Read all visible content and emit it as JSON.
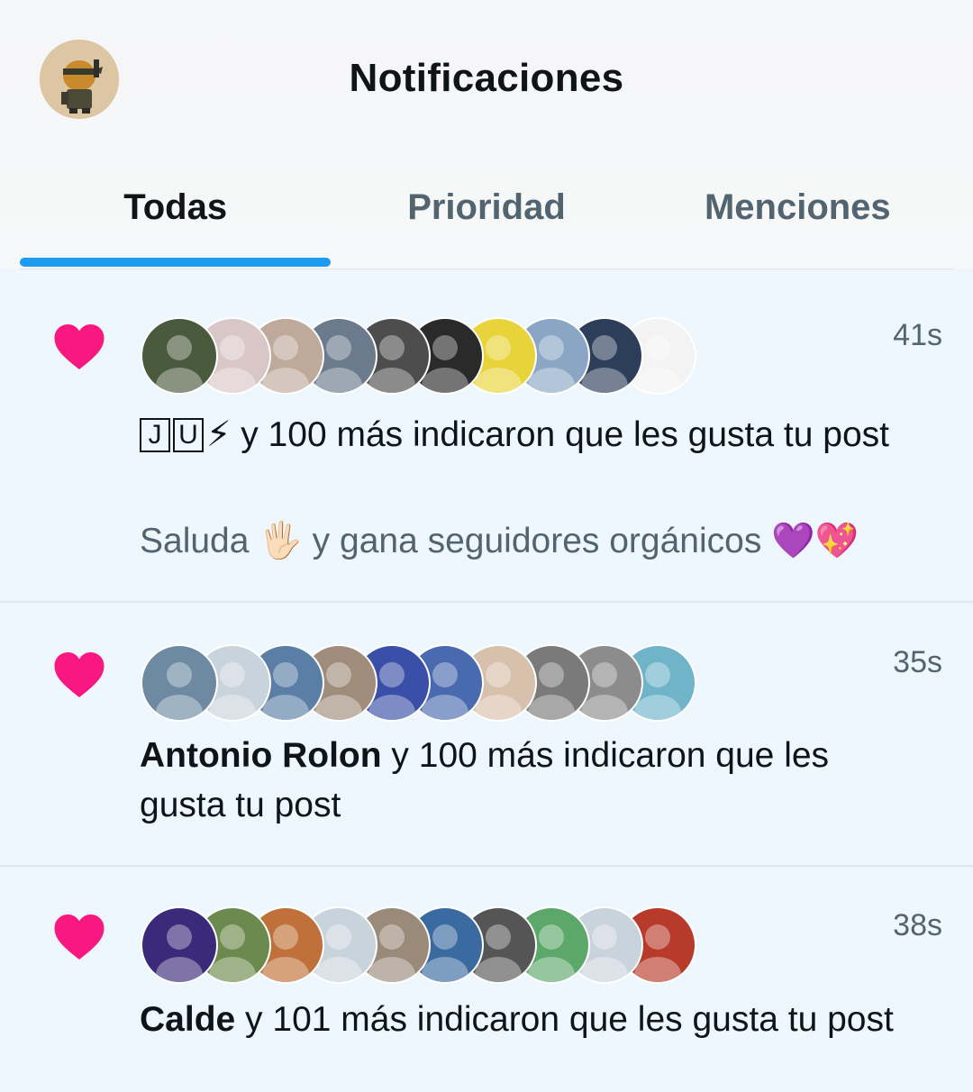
{
  "header": {
    "title": "Notificaciones"
  },
  "tabs": [
    {
      "label": "Todas",
      "active": true
    },
    {
      "label": "Prioridad",
      "active": false
    },
    {
      "label": "Menciones",
      "active": false
    }
  ],
  "notifications": [
    {
      "icon": "heart-icon",
      "time": "41s",
      "actor_box_chars": [
        "J",
        "U"
      ],
      "actor_suffix": "⚡",
      "action_text": " y 100 más indicaron que les gusta tu post",
      "subtext_before": "Saluda ",
      "subtext_emoji": "🖐🏻",
      "subtext_after": " y gana seguidores orgánicos 💜💖",
      "avatar_colors": [
        "#4a5a3c",
        "#d9c6c6",
        "#bfa99a",
        "#6b7a8c",
        "#4d4d4d",
        "#2a2a2a",
        "#e8d43a",
        "#8aa6c4",
        "#2d3e5a",
        "#f3f3f3"
      ]
    },
    {
      "icon": "heart-icon",
      "time": "35s",
      "actor": "Antonio Rolon",
      "action_text": " y 100 más indicaron que les gusta tu post",
      "avatar_colors": [
        "#6e8aa3",
        "#c9d3db",
        "#5a7ea6",
        "#a08c7a",
        "#3a4fa8",
        "#4a6ab0",
        "#d7c1ad",
        "#7a7a7a",
        "#8c8c8c",
        "#6fb4c9"
      ]
    },
    {
      "icon": "heart-icon",
      "time": "38s",
      "actor": "Calde",
      "action_text": " y 101 más indicaron que les gusta tu post",
      "avatar_colors": [
        "#3b2a7a",
        "#6c8a4e",
        "#c0703a",
        "#c9d3db",
        "#9a8a7a",
        "#3a6aa0",
        "#555555",
        "#5ca86a",
        "#c9d3db",
        "#b83a2a"
      ]
    }
  ]
}
